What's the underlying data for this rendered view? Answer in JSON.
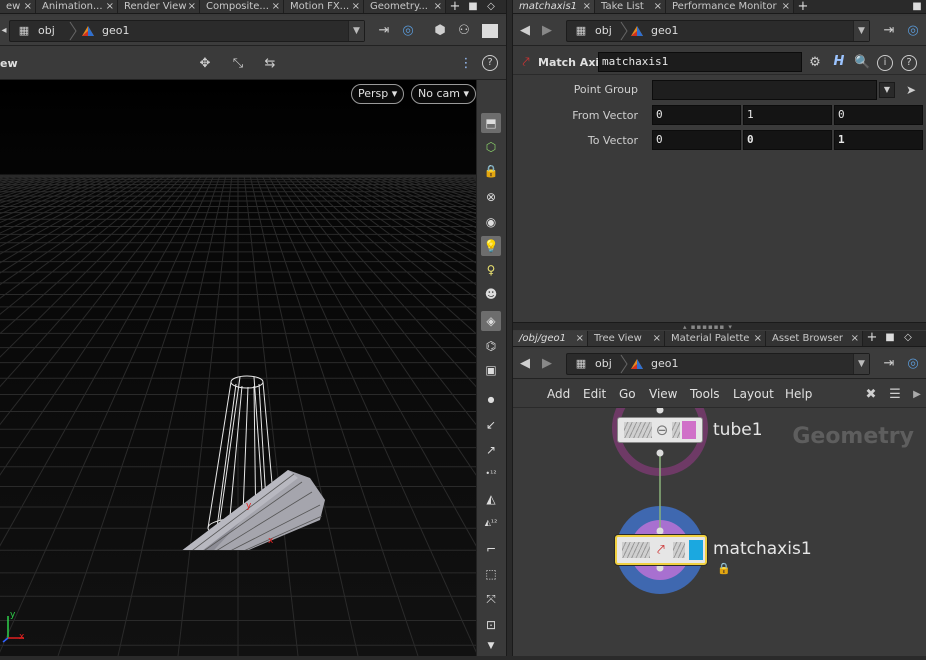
{
  "left_tabs": [
    {
      "label": "ew"
    },
    {
      "label": "Animation..."
    },
    {
      "label": "Render View"
    },
    {
      "label": "Composite..."
    },
    {
      "label": "Motion FX..."
    },
    {
      "label": "Geometry..."
    }
  ],
  "right_top_tabs": [
    {
      "label": "matchaxis1"
    },
    {
      "label": "Take List"
    },
    {
      "label": "Performance Monitor"
    }
  ],
  "right_bottom_tabs": [
    {
      "label": "/obj/geo1"
    },
    {
      "label": "Tree View"
    },
    {
      "label": "Material Palette"
    },
    {
      "label": "Asset Browser"
    }
  ],
  "path": {
    "obj": "obj",
    "geo": "geo1"
  },
  "viewport": {
    "title": "ew",
    "persp_label": "Persp",
    "cam_label": "No cam",
    "axis_x": "x",
    "axis_y": "y"
  },
  "params": {
    "node_type": "Match Axis",
    "node_name": "matchaxis1",
    "point_group_label": "Point Group",
    "point_group_value": "",
    "from_vector_label": "From Vector",
    "from_vector": [
      "0",
      "1",
      "0"
    ],
    "to_vector_label": "To Vector",
    "to_vector": [
      "0",
      "0",
      "1"
    ]
  },
  "network_menu": [
    "Add",
    "Edit",
    "Go",
    "View",
    "Tools",
    "Layout",
    "Help"
  ],
  "network": {
    "context_label": "Geometry",
    "nodes": [
      {
        "name": "tube1"
      },
      {
        "name": "matchaxis1"
      }
    ]
  },
  "colors": {
    "tube_flag": "#d070c8",
    "display_flag": "#1ba8e0",
    "selected_outline": "#f0d040",
    "template_ring": "#7a3a70",
    "display_ring": "#4a70b8"
  }
}
